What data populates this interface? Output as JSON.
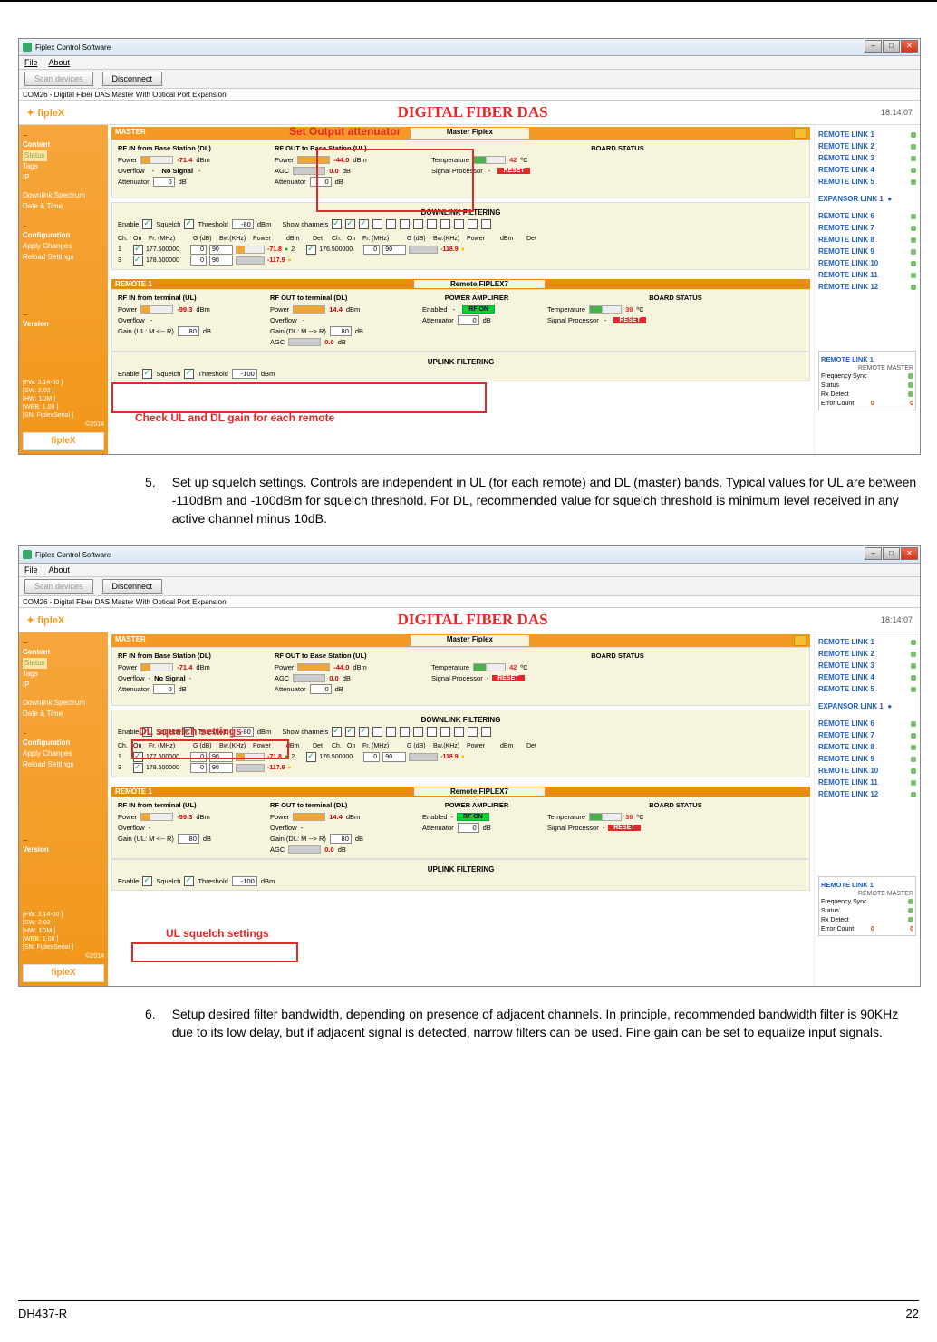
{
  "footer": {
    "doc": "DH437-R",
    "page": "22"
  },
  "steps": {
    "s5": {
      "num": "5.",
      "text": "Set up squelch settings. Controls are independent in UL (for each remote) and DL (master) bands. Typical values for UL are between -110dBm and -100dBm for squelch threshold. For DL, recommended value for squelch threshold is minimum level received in any active channel minus 10dB."
    },
    "s6": {
      "num": "6.",
      "text": "Setup desired filter bandwidth, depending on presence of adjacent channels. In principle, recommended bandwidth filter is 90KHz due to its low delay, but if adjacent signal is detected, narrow filters can be used. Fine gain can be set to equalize input signals."
    }
  },
  "app": {
    "title": "Fiplex Control Software",
    "menu": {
      "file": "File",
      "about": "About"
    },
    "toolbar": {
      "scan": "Scan devices",
      "disconnect": "Disconnect"
    },
    "comline": "COM26 - Digital Fiber DAS Master With Optical Port Expansion",
    "header": {
      "logo": "✦ fipleX",
      "title": "DIGITAL FIBER DAS",
      "time": "18:14:07"
    },
    "winbtns": {
      "min": "–",
      "max": "□",
      "close": "✕"
    },
    "sidebar": {
      "content": "Content",
      "status": "Status",
      "tags": "Tags",
      "ip": "IP",
      "spectrum": "Downlink Spectrum",
      "datetime": "Date & Time",
      "config": "Configuration",
      "apply": "Apply Changes",
      "reload": "Reload Settings",
      "version": "Version",
      "ver_fw": "[FW: 3.14-00 ]",
      "ver_sw": "[SW: 2.02 ]",
      "ver_hw": "[HW: 1DM ]",
      "ver_web": "[WEB: 1.08 ]",
      "ver_sn": "[SN: FiplexSerial ]",
      "copy": "©2014",
      "logo": "fipleX"
    },
    "right": {
      "links": [
        "REMOTE LINK 1",
        "REMOTE LINK 2",
        "REMOTE LINK 3",
        "REMOTE LINK 4",
        "REMOTE LINK 5",
        "REMOTE LINK 6",
        "REMOTE LINK 7",
        "REMOTE LINK 8",
        "REMOTE LINK 9",
        "REMOTE LINK 10",
        "REMOTE LINK 11",
        "REMOTE LINK 12"
      ],
      "expansor": "EXPANSOR LINK 1",
      "remotelink": "REMOTE LINK 1",
      "remotemaster": "REMOTE MASTER",
      "freqsync": "Frequency Sync",
      "status": "Status",
      "rxdetect": "Rx Detect",
      "errcount": "Error Count",
      "errval": "0"
    },
    "master": {
      "label": "MASTER",
      "name": "Master Fiplex",
      "rf_in": {
        "title": "RF IN from Base Station (DL)",
        "power": "Power",
        "pv": "-71.4",
        "dbm": "dBm",
        "overflow": "Overflow",
        "ns": "No Signal",
        "att": "Attenuator",
        "av": "0",
        "db": "dB"
      },
      "rf_out": {
        "title": "RF OUT to Base Station (UL)",
        "power": "Power",
        "pv": "-44.0",
        "dbm": "dBm",
        "agc": "AGC",
        "av": "0.0",
        "db": "dB",
        "att": "Attenuator",
        "atv": "0"
      },
      "board": {
        "title": "BOARD STATUS",
        "temp": "Temperature",
        "tv": "42",
        "tc": "ºC",
        "sig": "Signal Processor",
        "reset": "RESET"
      }
    },
    "dlfilter": {
      "title": "DOWNLINK FILTERING",
      "enable": "Enable",
      "squelch": "Squelch",
      "threshold": "Threshold",
      "thv": "-80",
      "dbm": "dBm",
      "showch": "Show channels",
      "cols": {
        "ch": "Ch.",
        "on": "On",
        "fr": "Fr. (MHz)",
        "g": "G (dB)",
        "bw": "Bw.(KHz)",
        "power": "Power",
        "dbm": "dBm",
        "det": "Det"
      },
      "rows": [
        {
          "ch": "1",
          "fr": "177.500000",
          "g": "0",
          "bw": "90",
          "dbm": "-71.8"
        },
        {
          "ch": "3",
          "fr": "178.500000",
          "g": "0",
          "bw": "90",
          "dbm": "-117.9"
        }
      ],
      "rrows": [
        {
          "ch": "2",
          "fr": "176.500000",
          "g": "0",
          "bw": "90",
          "dbm": "-118.9"
        }
      ]
    },
    "remote": {
      "label": "REMOTE 1",
      "name": "Remote FIPLEX7",
      "rf_in": {
        "title": "RF IN from terminal (UL)",
        "power": "Power",
        "pv": "-99.3",
        "dbm": "dBm",
        "overflow": "Overflow",
        "gain": "Gain (UL: M <-- R)",
        "gv": "80",
        "db": "dB"
      },
      "rf_out": {
        "title": "RF OUT to terminal (DL)",
        "power": "Power",
        "pv": "14.4",
        "dbm": "dBm",
        "overflow": "Overflow",
        "gain": "Gain (DL: M --> R)",
        "gv": "80",
        "db": "dB",
        "agc": "AGC",
        "av": "0.0"
      },
      "pa": {
        "title": "POWER AMPLIFIER",
        "enabled": "Enabled",
        "rfon": "RF ON",
        "att": "Attenuator",
        "av": "0",
        "db": "dB"
      },
      "board": {
        "title": "BOARD STATUS",
        "temp": "Temperature",
        "tv": "39",
        "tc": "ºC",
        "sig": "Signal Processor",
        "reset": "RESET"
      }
    },
    "ulfilter": {
      "title": "UPLINK FILTERING",
      "enable": "Enable",
      "squelch": "Squelch",
      "threshold": "Threshold",
      "thv": "-100",
      "dbm": "dBm"
    }
  },
  "annotations": {
    "s1": {
      "a1": "Set Output attenuator",
      "a2": "Check UL and DL gain for each remote"
    },
    "s2": {
      "a1": "DL squelch settings",
      "a2": "UL squelch settings"
    }
  }
}
